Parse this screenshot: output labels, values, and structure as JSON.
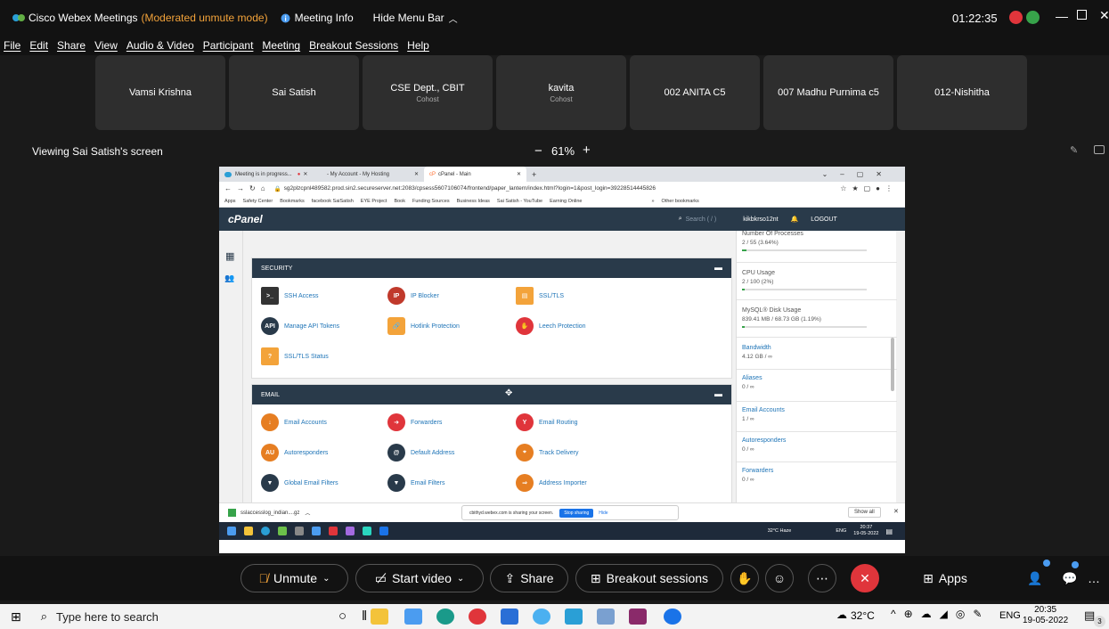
{
  "titlebar": {
    "app": "Cisco Webex Meetings",
    "mode": "(Moderated unmute mode)",
    "meeting_info": "Meeting Info",
    "hide_menu": "Hide Menu Bar",
    "time": "01:22:35"
  },
  "menu": [
    "File",
    "Edit",
    "Share",
    "View",
    "Audio & Video",
    "Participant",
    "Meeting",
    "Breakout Sessions",
    "Help"
  ],
  "participants": [
    {
      "name": "Vamsi Krishna",
      "role": ""
    },
    {
      "name": "Sai Satish",
      "role": ""
    },
    {
      "name": "CSE Dept., CBIT",
      "role": "Cohost"
    },
    {
      "name": "kavita",
      "role": "Cohost"
    },
    {
      "name": "002 ANITA C5",
      "role": ""
    },
    {
      "name": "007 Madhu Purnima c5",
      "role": ""
    },
    {
      "name": "012-Nishitha",
      "role": ""
    }
  ],
  "viewing": "Viewing Sai Satish's screen",
  "zoom": {
    "minus": "−",
    "level": "61%",
    "plus": "+"
  },
  "browser": {
    "tabs": [
      "Meeting is in progress...",
      "- My Account - My Hosting",
      "cPanel - Main",
      "+"
    ],
    "url": "sg2plzcpnl489582.prod.sin2.secureserver.net:2083/cpsess5607106074/frontend/paper_lantern/index.html?login=1&post_login=39228514445826",
    "bookmarks": [
      "Apps",
      "Safety Center",
      "Bookmarks",
      "facebook SaiSatish",
      "EYE Project",
      "Book",
      "Funding Sources",
      "Business Ideas",
      "Sai Satish - YouTube",
      "Earning Online",
      "»",
      "Other bookmarks"
    ]
  },
  "cpanel": {
    "logo": "cPanel",
    "search": "Search ( / )",
    "user": "kikbkrso12nt",
    "logout": "LOGOUT",
    "security": {
      "title": "SECURITY",
      "items": [
        "SSH Access",
        "IP Blocker",
        "SSL/TLS",
        "Manage API Tokens",
        "Hotlink Protection",
        "Leech Protection",
        "SSL/TLS Status"
      ]
    },
    "email": {
      "title": "EMAIL",
      "items": [
        "Email Accounts",
        "Forwarders",
        "Email Routing",
        "Autoresponders",
        "Default Address",
        "Track Delivery",
        "Global Email Filters",
        "Email Filters",
        "Address Importer"
      ]
    },
    "stats": [
      {
        "label": "Number Of Processes",
        "value": "2 / 55  (3.64%)",
        "pct": 3.64
      },
      {
        "label": "CPU Usage",
        "value": "2 / 100  (2%)",
        "pct": 2
      },
      {
        "label": "MySQL® Disk Usage",
        "value": "839.41 MB / 68.73 GB  (1.19%)",
        "pct": 1.19
      },
      {
        "label": "Bandwidth",
        "value": "4.12 GB / ∞"
      },
      {
        "label": "Aliases",
        "value": "0 / ∞"
      },
      {
        "label": "Email Accounts",
        "value": "1 / ∞"
      },
      {
        "label": "Autoresponders",
        "value": "0 / ∞"
      },
      {
        "label": "Forwarders",
        "value": "0 / ∞"
      }
    ]
  },
  "download": {
    "file": "sslaccesslog_indian....gz",
    "show_all": "Show all"
  },
  "share_banner": {
    "text": "cbithyd.webex.com is sharing your screen.",
    "stop": "Stop sharing",
    "hide": "Hide"
  },
  "inner_taskbar": {
    "weather": "32°C  Haze",
    "lang": "ENG",
    "time": "20:37",
    "date": "19-05-2022"
  },
  "controls": {
    "unmute": "Unmute",
    "video": "Start video",
    "share": "Share",
    "breakout": "Breakout sessions",
    "apps": "Apps"
  },
  "taskbar": {
    "search": "Type here to search",
    "temp": "32°C",
    "lang": "ENG",
    "time": "20:35",
    "date": "19-05-2022",
    "badge": "3"
  },
  "colors": {
    "accent_orange": "#f3a33a",
    "end_red": "#e0353b",
    "cpanel_navy": "#293a4a",
    "stop_blue": "#1a73e8"
  }
}
